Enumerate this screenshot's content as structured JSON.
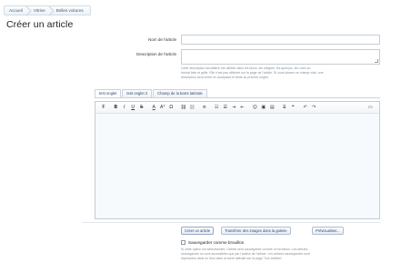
{
  "breadcrumb": [
    "Accueil",
    "Vitrine",
    "Belles voitures"
  ],
  "page_title": "Créer un article",
  "form": {
    "title_label": "Nom de l'article",
    "title_value": "",
    "description_label": "Description de l'article",
    "description_value": "",
    "description_hint_1": "Cette description facultative est utilisée dans les blocs, les widgets, les aperçus, les vues au",
    "description_hint_2": "format liste et grille. Elle n'est pas affichée sur la page de l'article. Si vous laissez ce champ vide, une",
    "description_hint_3": "description sera créée en analysant le texte du premier onglet."
  },
  "tabs": [
    "test onglet",
    "test onglet 2",
    "Champ de la barre latérale"
  ],
  "toolbar_icons": [
    "clear-format-icon",
    "bold-icon",
    "italic-icon",
    "underline-icon",
    "strikethrough-icon",
    "text-color-icon",
    "font-size-icon",
    "special-chars-icon",
    "link-icon",
    "unlink-icon",
    "align-icon",
    "bullet-list-icon",
    "numbered-list-icon",
    "indent-icon",
    "outdent-icon",
    "smiley-icon",
    "image-icon",
    "media-icon",
    "code-icon",
    "quote-icon",
    "undo-icon",
    "redo-icon",
    "source-icon"
  ],
  "toolbar_glyphs": [
    "T̶",
    "B",
    "I",
    "U",
    "S",
    "A",
    "A²",
    "Ω",
    "⛓",
    "⛓",
    "≡",
    "☷",
    "☰",
    "⇥",
    "⇤",
    "☺",
    "▣",
    "▤",
    "⌸",
    "❝",
    "↶",
    "↷",
    "▭"
  ],
  "actions": {
    "create": "Créer un article",
    "transfer": "Transférer des images dans la galerie",
    "preview": "Prévisualiser..."
  },
  "draft": {
    "label": "Sauvegarder comme brouillon",
    "checked": false,
    "hint_1": "Si cette option est sélectionnée, l'article sera sauvegardé comme un brouillon. Les articles",
    "hint_2": "sauvegardés ne sont accessibles que par l'auteur de l'article. Les articles sauvegardés sont",
    "hint_3": "répertoriés dans un bloc dans la barre latérale sur la page \"Vos articles\"."
  }
}
